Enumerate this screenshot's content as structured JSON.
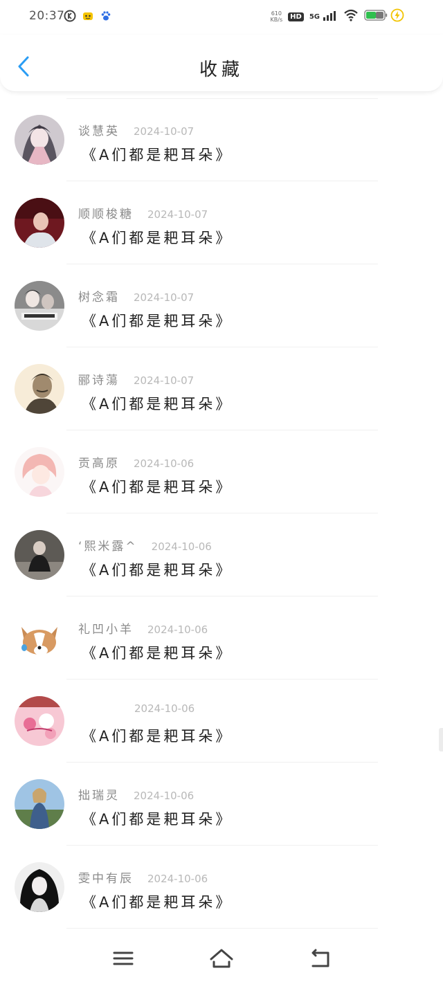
{
  "status_bar": {
    "time": "20:37",
    "net_speed_value": "610",
    "net_speed_unit": "KB/s",
    "hd": "HD",
    "network": "5G",
    "icons": [
      "k-app-icon",
      "smiley-app-icon",
      "paw-app-icon",
      "hd-icon",
      "signal-icon",
      "wifi-icon",
      "battery-icon",
      "charging-icon"
    ]
  },
  "header": {
    "title": "收藏",
    "back_icon": "chevron-left-icon",
    "accent_color": "#2a9df4"
  },
  "favorites": [
    {
      "name": "谈慧英",
      "date": "2024-10-07",
      "title": "《A们都是耙耳朵》"
    },
    {
      "name": "顺顺梭糖",
      "date": "2024-10-07",
      "title": "《A们都是耙耳朵》"
    },
    {
      "name": "树念霜",
      "date": "2024-10-07",
      "title": "《A们都是耙耳朵》"
    },
    {
      "name": "郦诗蕩",
      "date": "2024-10-07",
      "title": "《A们都是耙耳朵》"
    },
    {
      "name": "贡高原",
      "date": "2024-10-06",
      "title": "《A们都是耙耳朵》"
    },
    {
      "name": "‘熙米露^",
      "date": "2024-10-06",
      "title": "《A们都是耙耳朵》"
    },
    {
      "name": "礼凹小羊",
      "date": "2024-10-06",
      "title": "《A们都是耙耳朵》"
    },
    {
      "name": "",
      "date": "2024-10-06",
      "title": "《A们都是耙耳朵》"
    },
    {
      "name": "拙瑞灵",
      "date": "2024-10-06",
      "title": "《A们都是耙耳朵》"
    },
    {
      "name": "雯中有辰",
      "date": "2024-10-06",
      "title": "《A们都是耙耳朵》"
    }
  ],
  "nav_bar": {
    "icons": [
      "menu-icon",
      "home-icon",
      "back-icon"
    ]
  }
}
